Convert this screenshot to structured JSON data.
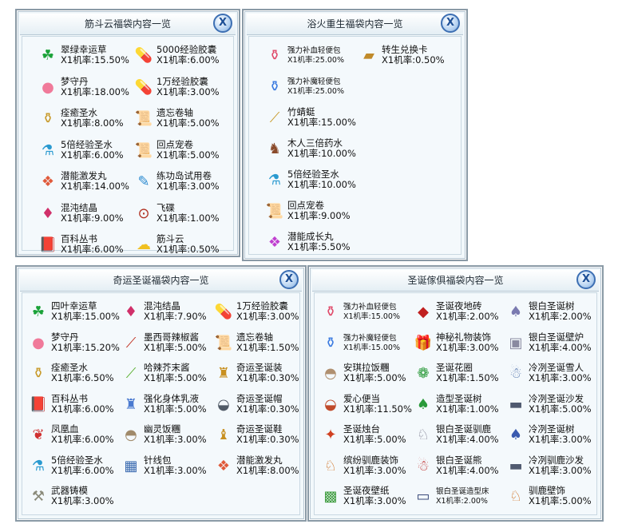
{
  "close_glyph": "X",
  "panels": [
    {
      "title": "筋斗云福袋内容一览",
      "items": [
        {
          "name": "翠绿幸运草",
          "rate": "X1机率:15.50%",
          "icon": "clover-icon",
          "glyph": "☘",
          "color": "#1aa238"
        },
        {
          "name": "5000经验胶囊",
          "rate": "X1机率:6.00%",
          "icon": "capsule-icon",
          "glyph": "💊",
          "color": "#2fb84a"
        },
        {
          "name": "梦守丹",
          "rate": "X1机率:18.00%",
          "icon": "pill-icon",
          "glyph": "●",
          "color": "#f07a9a"
        },
        {
          "name": "1万经验胶囊",
          "rate": "X1机率:3.00%",
          "icon": "capsule-icon",
          "glyph": "💊",
          "color": "#2f8fd8"
        },
        {
          "name": "痊癒圣水",
          "rate": "X1机率:8.00%",
          "icon": "potion-icon",
          "glyph": "⚱",
          "color": "#c89a2a"
        },
        {
          "name": "遗忘卷轴",
          "rate": "X1机率:5.00%",
          "icon": "scroll-icon",
          "glyph": "📜",
          "color": "#8a5a2a"
        },
        {
          "name": "5倍经验圣水",
          "rate": "X1机率:6.00%",
          "icon": "flask-icon",
          "glyph": "⚗",
          "color": "#2a9ad0"
        },
        {
          "name": "回点宠卷",
          "rate": "X1机率:5.00%",
          "icon": "scroll-icon",
          "glyph": "📜",
          "color": "#d07a2a"
        },
        {
          "name": "潜能激发丸",
          "rate": "X1机率:14.00%",
          "icon": "pills-icon",
          "glyph": "❖",
          "color": "#e05a3a"
        },
        {
          "name": "练功岛试用卷",
          "rate": "X1机率:3.00%",
          "icon": "ticket-icon",
          "glyph": "✎",
          "color": "#2a8ad0"
        },
        {
          "name": "混沌结晶",
          "rate": "X1机率:9.00%",
          "icon": "crystal-icon",
          "glyph": "♦",
          "color": "#d0306a"
        },
        {
          "name": "飞碟",
          "rate": "X1机率:1.00%",
          "icon": "ufo-icon",
          "glyph": "⊙",
          "color": "#b03020"
        },
        {
          "name": "百科丛书",
          "rate": "X1机率:6.00%",
          "icon": "book-icon",
          "glyph": "📕",
          "color": "#2a6ad0"
        },
        {
          "name": "筋斗云",
          "rate": "X1机率:0.50%",
          "icon": "cloud-icon",
          "glyph": "☁",
          "color": "#f0c020"
        }
      ]
    },
    {
      "title": "浴火重生福袋内容一览",
      "items": [
        {
          "name": "强力补血轻便包",
          "rate": "X1机率:25.00%",
          "icon": "potion-pack-icon",
          "glyph": "⚱",
          "color": "#e04a6a",
          "small": true
        },
        {
          "name": "转生兑换卡",
          "rate": "X1机率:0.50%",
          "icon": "card-icon",
          "glyph": "▰",
          "color": "#c08a2a"
        },
        {
          "name": "强力补魔轻便包",
          "rate": "X1机率:25.00%",
          "icon": "potion-pack-icon",
          "glyph": "⚱",
          "color": "#3a7ae0",
          "small": true
        },
        {
          "name": "竹蜻蜓",
          "rate": "X1机率:15.00%",
          "icon": "bamboo-copter-icon",
          "glyph": "⟋",
          "color": "#c89a2a"
        },
        {
          "name": "木人三倍药水",
          "rate": "X1机率:10.00%",
          "icon": "wooden-man-icon",
          "glyph": "♞",
          "color": "#8a4a2a"
        },
        {
          "name": "5倍经验圣水",
          "rate": "X1机率:10.00%",
          "icon": "flask-icon",
          "glyph": "⚗",
          "color": "#2a9ad0"
        },
        {
          "name": "回点宠卷",
          "rate": "X1机率:9.00%",
          "icon": "scroll-icon",
          "glyph": "📜",
          "color": "#d07a2a"
        },
        {
          "name": "潜能成长丸",
          "rate": "X1机率:5.50%",
          "icon": "pills-icon",
          "glyph": "❖",
          "color": "#c040d0"
        }
      ]
    },
    {
      "title": "奇运圣诞福袋内容一览",
      "items": [
        {
          "name": "四叶幸运草",
          "rate": "X1机率:15.00%",
          "icon": "clover-icon",
          "glyph": "☘",
          "color": "#1aa238"
        },
        {
          "name": "混沌结晶",
          "rate": "X1机率:7.90%",
          "icon": "crystal-icon",
          "glyph": "♦",
          "color": "#d0306a"
        },
        {
          "name": "1万经验胶囊",
          "rate": "X1机率:3.00%",
          "icon": "capsule-icon",
          "glyph": "💊",
          "color": "#2f8fd8"
        },
        {
          "name": "梦守丹",
          "rate": "X1机率:15.20%",
          "icon": "pill-icon",
          "glyph": "●",
          "color": "#f07a9a"
        },
        {
          "name": "墨西哥辣椒酱",
          "rate": "X1机率:5.00%",
          "icon": "chili-icon",
          "glyph": "⟋",
          "color": "#c03020"
        },
        {
          "name": "遗忘卷轴",
          "rate": "X1机率:1.50%",
          "icon": "scroll-icon",
          "glyph": "📜",
          "color": "#8a5a2a"
        },
        {
          "name": "痊癒圣水",
          "rate": "X1机率:6.50%",
          "icon": "potion-icon",
          "glyph": "⚱",
          "color": "#c89a2a"
        },
        {
          "name": "哈辣芥末酱",
          "rate": "X1机率:5.00%",
          "icon": "mustard-icon",
          "glyph": "⟋",
          "color": "#5ab030"
        },
        {
          "name": "奇运圣诞装",
          "rate": "X1机率:0.30%",
          "icon": "costume-icon",
          "glyph": "♜",
          "color": "#c89020"
        },
        {
          "name": "百科丛书",
          "rate": "X1机率:6.00%",
          "icon": "book-icon",
          "glyph": "📕",
          "color": "#2a6ad0"
        },
        {
          "name": "强化身体乳液",
          "rate": "X1机率:5.00%",
          "icon": "lotion-icon",
          "glyph": "♜",
          "color": "#4a7ad0"
        },
        {
          "name": "奇运圣诞帽",
          "rate": "X1机率:0.30%",
          "icon": "hat-icon",
          "glyph": "◒",
          "color": "#505a66"
        },
        {
          "name": "凤凰血",
          "rate": "X1机率:6.00%",
          "icon": "phoenix-blood-icon",
          "glyph": "❦",
          "color": "#d03030"
        },
        {
          "name": "幽灵饭糰",
          "rate": "X1机率:3.00%",
          "icon": "rice-ball-icon",
          "glyph": "◓",
          "color": "#a08a6a"
        },
        {
          "name": "奇运圣诞鞋",
          "rate": "X1机率:0.30%",
          "icon": "shoes-icon",
          "glyph": "♝",
          "color": "#c89020"
        },
        {
          "name": "5倍经验圣水",
          "rate": "X1机率:6.00%",
          "icon": "flask-icon",
          "glyph": "⚗",
          "color": "#2a9ad0"
        },
        {
          "name": "针线包",
          "rate": "X1机率:3.00%",
          "icon": "sewing-kit-icon",
          "glyph": "▦",
          "color": "#3a6ab0"
        },
        {
          "name": "潜能激发丸",
          "rate": "X1机率:8.00%",
          "icon": "pills-icon",
          "glyph": "❖",
          "color": "#e05a3a"
        },
        {
          "name": "武器铸模",
          "rate": "X1机率:3.00%",
          "icon": "weapon-mold-icon",
          "glyph": "⚒",
          "color": "#8a8a7a"
        }
      ]
    },
    {
      "title": "圣诞傢俱福袋内容一览",
      "items": [
        {
          "name": "强力补血轻便包",
          "rate": "X1机率:15.00%",
          "icon": "potion-pack-icon",
          "glyph": "⚱",
          "color": "#e04a6a",
          "small": true
        },
        {
          "name": "圣诞夜地砖",
          "rate": "X1机率:2.00%",
          "icon": "floor-tile-icon",
          "glyph": "◆",
          "color": "#c02020"
        },
        {
          "name": "银白圣诞树",
          "rate": "X1机率:2.00%",
          "icon": "tree-icon",
          "glyph": "♠",
          "color": "#7a7ab0"
        },
        {
          "name": "强力补魔轻便包",
          "rate": "X1机率:15.00%",
          "icon": "potion-pack-icon",
          "glyph": "⚱",
          "color": "#3a7ae0",
          "small": true
        },
        {
          "name": "神秘礼物装饰",
          "rate": "X1机率:3.00%",
          "icon": "gift-icon",
          "glyph": "🎁",
          "color": "#d03030"
        },
        {
          "name": "银白圣诞壁炉",
          "rate": "X1机率:4.00%",
          "icon": "fireplace-icon",
          "glyph": "▣",
          "color": "#8a8aa0"
        },
        {
          "name": "安琪拉饭糰",
          "rate": "X1机率:5.00%",
          "icon": "rice-ball-icon",
          "glyph": "◓",
          "color": "#b09070"
        },
        {
          "name": "圣诞花圈",
          "rate": "X1机率:1.50%",
          "icon": "wreath-icon",
          "glyph": "❁",
          "color": "#2a9a3a"
        },
        {
          "name": "冷冽圣诞雪人",
          "rate": "X1机率:3.00%",
          "icon": "snowman-icon",
          "glyph": "☃",
          "color": "#5a7ab0"
        },
        {
          "name": "爱心便当",
          "rate": "X1机率:11.50%",
          "icon": "bento-icon",
          "glyph": "◒",
          "color": "#c04a2a"
        },
        {
          "name": "造型圣诞树",
          "rate": "X1机率:1.00%",
          "icon": "tree-icon",
          "glyph": "♠",
          "color": "#2a9a3a"
        },
        {
          "name": "冷冽圣诞沙发",
          "rate": "X1机率:5.00%",
          "icon": "sofa-icon",
          "glyph": "▬",
          "color": "#505a70"
        },
        {
          "name": "圣诞烛台",
          "rate": "X1机率:5.00%",
          "icon": "candle-icon",
          "glyph": "✦",
          "color": "#d04020"
        },
        {
          "name": "银白圣诞驯鹿",
          "rate": "X1机率:4.00%",
          "icon": "reindeer-icon",
          "glyph": "♘",
          "color": "#8a8a9a"
        },
        {
          "name": "冷冽圣诞树",
          "rate": "X1机率:3.00%",
          "icon": "tree-icon",
          "glyph": "♠",
          "color": "#3a5ab0"
        },
        {
          "name": "缤纷驯鹿装饰",
          "rate": "X1机率:3.00%",
          "icon": "reindeer-icon",
          "glyph": "♘",
          "color": "#d07020"
        },
        {
          "name": "银白圣诞熊",
          "rate": "X1机率:4.00%",
          "icon": "bear-icon",
          "glyph": "☃",
          "color": "#c03030"
        },
        {
          "name": "冷冽驯鹿沙发",
          "rate": "X1机率:3.00%",
          "icon": "sofa-icon",
          "glyph": "▬",
          "color": "#505a70"
        },
        {
          "name": "圣诞夜壁纸",
          "rate": "X1机率:3.00%",
          "icon": "wallpaper-icon",
          "glyph": "▩",
          "color": "#3a9a3a"
        },
        {
          "name": "银白圣诞造型床",
          "rate": "X1机率:2.00%",
          "icon": "bed-icon",
          "glyph": "▭",
          "color": "#3a4a7a",
          "small": true
        },
        {
          "name": "驯鹿壁饰",
          "rate": "X1机率:5.00%",
          "icon": "reindeer-icon",
          "glyph": "♘",
          "color": "#d07020"
        }
      ]
    }
  ]
}
